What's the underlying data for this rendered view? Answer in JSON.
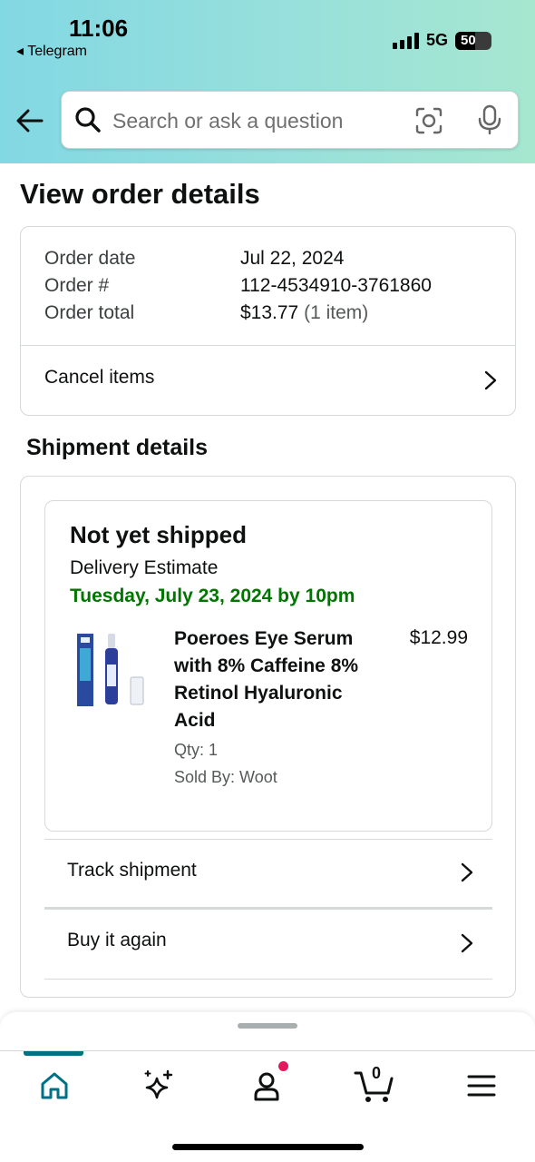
{
  "status_bar": {
    "time": "11:06",
    "back_app": "◂ Telegram",
    "network": "5G",
    "battery": "50"
  },
  "search": {
    "placeholder": "Search or ask a question"
  },
  "page": {
    "title": "View order details"
  },
  "order": {
    "rows": [
      {
        "label": "Order date",
        "value": "Jul 22, 2024"
      },
      {
        "label": "Order #",
        "value": "112-4534910-3761860"
      },
      {
        "label": "Order total",
        "value": "$13.77",
        "extra": "(1 item)"
      }
    ],
    "cancel_label": "Cancel items"
  },
  "shipment": {
    "heading": "Shipment details",
    "status": "Not yet shipped",
    "delivery_label": "Delivery Estimate",
    "delivery_date": "Tuesday, July 23, 2024 by 10pm",
    "product": {
      "name": "Poeroes Eye Serum with 8% Caffeine 8% Retinol Hyaluronic Acid",
      "price": "$12.99",
      "qty": "Qty: 1",
      "sold_by": "Sold By: Woot"
    },
    "track_label": "Track shipment",
    "buy_again_label": "Buy it again"
  },
  "bottom_nav": {
    "items": [
      "home-icon",
      "rufus-sparkle-icon",
      "account-icon",
      "cart-icon",
      "menu-icon"
    ],
    "cart_count": "0",
    "accent": "#007185"
  },
  "colors": {
    "delivery_green": "#007600",
    "header_gradient_start": "#82d8e3",
    "header_gradient_end": "#a6e7d0",
    "notification_dot": "#e0185d"
  }
}
